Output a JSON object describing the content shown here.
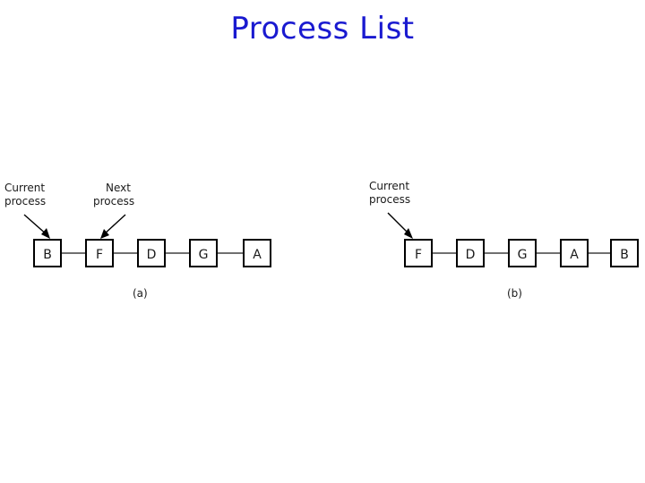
{
  "slide": {
    "title": "Process List",
    "title_color": "#1a1ad0",
    "background_color": "#ffffff"
  },
  "figures": [
    {
      "id": "a",
      "caption": "(a)",
      "boxes": [
        {
          "label": "B"
        },
        {
          "label": "F"
        },
        {
          "label": "D"
        },
        {
          "label": "G"
        },
        {
          "label": "A"
        }
      ],
      "annotations": [
        {
          "name": "current-process",
          "line1": "Current",
          "line2": "process",
          "target_box": "B"
        },
        {
          "name": "next-process",
          "line1": "Next",
          "line2": "process",
          "target_box": "F"
        }
      ]
    },
    {
      "id": "b",
      "caption": "(b)",
      "boxes": [
        {
          "label": "F"
        },
        {
          "label": "D"
        },
        {
          "label": "G"
        },
        {
          "label": "A"
        },
        {
          "label": "B"
        }
      ],
      "annotations": [
        {
          "name": "current-process",
          "line1": "Current",
          "line2": "process",
          "target_box": "F"
        }
      ]
    }
  ],
  "style": {
    "box_stroke": "#000000",
    "box_fill": "#ffffff",
    "line_stroke": "#1a1a1a",
    "label_color": "#1a1a1a"
  }
}
